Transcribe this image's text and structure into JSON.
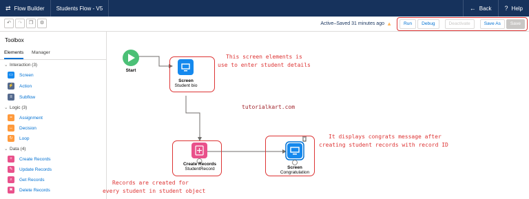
{
  "header": {
    "app_name": "Flow Builder",
    "flow_name": "Students Flow - V5",
    "back_label": "Back",
    "help_label": "Help"
  },
  "toolbar": {
    "status": "Active–Saved 31 minutes ago",
    "buttons": {
      "run": "Run",
      "debug": "Debug",
      "deactivate": "Deactivate",
      "save_as": "Save As",
      "save": "Save"
    }
  },
  "sidebar": {
    "title": "Toolbox",
    "tabs": [
      "Elements",
      "Manager"
    ],
    "sections": [
      {
        "label": "Interaction (3)",
        "items": [
          {
            "label": "Screen",
            "icon": "screen-icon",
            "color": "#1589ee"
          },
          {
            "label": "Action",
            "icon": "action-icon",
            "color": "#54698d"
          },
          {
            "label": "Subflow",
            "icon": "subflow-icon",
            "color": "#54698d"
          }
        ]
      },
      {
        "label": "Logic (3)",
        "items": [
          {
            "label": "Assignment",
            "icon": "assignment-icon",
            "color": "#ff9a3c"
          },
          {
            "label": "Decision",
            "icon": "decision-icon",
            "color": "#ff9a3c"
          },
          {
            "label": "Loop",
            "icon": "loop-icon",
            "color": "#ff9a3c"
          }
        ]
      },
      {
        "label": "Data (4)",
        "items": [
          {
            "label": "Create Records",
            "icon": "create-records-icon",
            "color": "#e9518b"
          },
          {
            "label": "Update Records",
            "icon": "update-records-icon",
            "color": "#e9518b"
          },
          {
            "label": "Get Records",
            "icon": "get-records-icon",
            "color": "#e9518b"
          },
          {
            "label": "Delete Records",
            "icon": "delete-records-icon",
            "color": "#e9518b"
          }
        ]
      }
    ]
  },
  "canvas": {
    "nodes": {
      "start": {
        "label": "Start"
      },
      "screen_bio": {
        "type": "Screen",
        "name": "Student bio"
      },
      "create_records": {
        "type": "Create Records",
        "name": "StudentRecord"
      },
      "screen_congrats": {
        "type": "Screen",
        "name": "Congratulation"
      }
    },
    "notes": {
      "screen_note_1": "This screen elements is",
      "screen_note_2": "use to enter student details",
      "site": "tutorialkart.com",
      "congrats_note_1": "It displays congrats message after",
      "congrats_note_2": "creating student records with record ID",
      "records_note_1": "Records are created for",
      "records_note_2": "every student in student object"
    }
  },
  "colors": {
    "header_bg": "#16325c",
    "accent": "#0070d2",
    "annotation_red": "#d33333",
    "screen_node": "#1589ee",
    "data_node": "#e9518b",
    "start_node": "#4bc076"
  }
}
